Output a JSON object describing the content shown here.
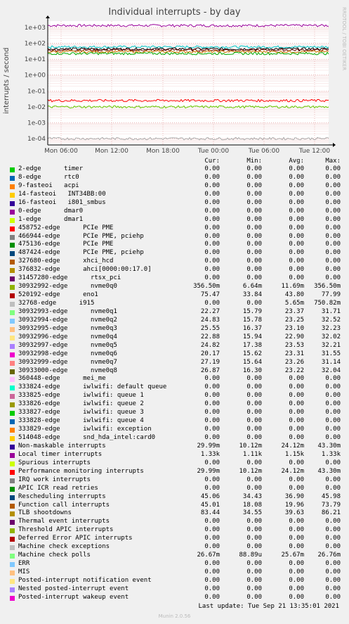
{
  "chart_data": {
    "type": "line",
    "title": "Individual interrupts - by day",
    "ylabel": "interrupts / second",
    "y_scale": "log",
    "yticks": [
      "1e+03",
      "1e+02",
      "1e+01",
      "1e+00",
      "1e-01",
      "1e-02",
      "1e-03",
      "1e-04"
    ],
    "xticks": [
      "Mon 06:00",
      "Mon 12:00",
      "Mon 18:00",
      "Tue 00:00",
      "Tue 06:00",
      "Tue 12:00"
    ],
    "side_label": "RRDTOOL / TOBI OETIKER",
    "grid": true,
    "series_bands": [
      {
        "color": "#990099",
        "level": 1330
      },
      {
        "color": "#00cccc",
        "level": 60
      },
      {
        "color": "#000000",
        "level": 45
      },
      {
        "color": "#660000",
        "level": 38
      },
      {
        "color": "#cc7700",
        "level": 30
      },
      {
        "color": "#00aa00",
        "level": 23
      },
      {
        "color": "#ff0000",
        "level": 0.025
      },
      {
        "color": "#66cc00",
        "level": 0.01
      },
      {
        "color": "#aaaaaa",
        "level": 0.0001
      }
    ],
    "legend_columns": [
      "Cur:",
      "Min:",
      "Avg:",
      "Max:"
    ],
    "rows": [
      {
        "name": "2-edge      timer",
        "color": "#00cc00",
        "cur": "0.00",
        "min": "0.00",
        "avg": "0.00",
        "max": "0.00"
      },
      {
        "name": "8-edge      rtc0",
        "color": "#0066b3",
        "cur": "0.00",
        "min": "0.00",
        "avg": "0.00",
        "max": "0.00"
      },
      {
        "name": "9-fasteoi   acpi",
        "color": "#ff8000",
        "cur": "0.00",
        "min": "0.00",
        "avg": "0.00",
        "max": "0.00"
      },
      {
        "name": "14-fasteoi   INT34BB:00",
        "color": "#ffcc00",
        "cur": "0.00",
        "min": "0.00",
        "avg": "0.00",
        "max": "0.00"
      },
      {
        "name": "16-fasteoi   i801_smbus",
        "color": "#330099",
        "cur": "0.00",
        "min": "0.00",
        "avg": "0.00",
        "max": "0.00"
      },
      {
        "name": "0-edge      dmar0",
        "color": "#990099",
        "cur": "0.00",
        "min": "0.00",
        "avg": "0.00",
        "max": "0.00"
      },
      {
        "name": "1-edge      dmar1",
        "color": "#ccff00",
        "cur": "0.00",
        "min": "0.00",
        "avg": "0.00",
        "max": "0.00"
      },
      {
        "name": "458752-edge      PCIe PME",
        "color": "#ff0000",
        "cur": "0.00",
        "min": "0.00",
        "avg": "0.00",
        "max": "0.00"
      },
      {
        "name": "466944-edge      PCIe PME, pciehp",
        "color": "#808080",
        "cur": "0.00",
        "min": "0.00",
        "avg": "0.00",
        "max": "0.00"
      },
      {
        "name": "475136-edge      PCIe PME",
        "color": "#008f00",
        "cur": "0.00",
        "min": "0.00",
        "avg": "0.00",
        "max": "0.00"
      },
      {
        "name": "487424-edge      PCIe PME, pciehp",
        "color": "#00487d",
        "cur": "0.00",
        "min": "0.00",
        "avg": "0.00",
        "max": "0.00"
      },
      {
        "name": "327680-edge      xhci_hcd",
        "color": "#b35a00",
        "cur": "0.00",
        "min": "0.00",
        "avg": "0.00",
        "max": "0.00"
      },
      {
        "name": "376832-edge      ahci[0000:00:17.0]",
        "color": "#b38f00",
        "cur": "0.00",
        "min": "0.00",
        "avg": "0.00",
        "max": "0.00"
      },
      {
        "name": "31457280-edge      rtsx_pci",
        "color": "#6b006b",
        "cur": "0.00",
        "min": "0.00",
        "avg": "0.00",
        "max": "0.00"
      },
      {
        "name": "30932992-edge      nvme0q0",
        "color": "#8fb300",
        "cur": "356.50m",
        "min": "6.64m",
        "avg": "11.69m",
        "max": "356.50m"
      },
      {
        "name": "520192-edge      eno1",
        "color": "#b30000",
        "cur": "75.47",
        "min": "33.84",
        "avg": "43.80",
        "max": "77.99"
      },
      {
        "name": "32768-edge      i915",
        "color": "#bebebe",
        "cur": "0.00",
        "min": "0.00",
        "avg": "5.65m",
        "max": "750.82m"
      },
      {
        "name": "30932993-edge      nvme0q1",
        "color": "#80ff80",
        "cur": "22.27",
        "min": "15.79",
        "avg": "23.37",
        "max": "31.71"
      },
      {
        "name": "30932994-edge      nvme0q2",
        "color": "#80c9ff",
        "cur": "24.83",
        "min": "15.78",
        "avg": "23.25",
        "max": "32.52"
      },
      {
        "name": "30932995-edge      nvme0q3",
        "color": "#ffc080",
        "cur": "25.55",
        "min": "16.37",
        "avg": "23.10",
        "max": "32.23"
      },
      {
        "name": "30932996-edge      nvme0q4",
        "color": "#ffe680",
        "cur": "22.88",
        "min": "15.94",
        "avg": "22.90",
        "max": "32.02"
      },
      {
        "name": "30932997-edge      nvme0q5",
        "color": "#aa80ff",
        "cur": "24.82",
        "min": "17.38",
        "avg": "23.53",
        "max": "32.21"
      },
      {
        "name": "30932998-edge      nvme0q6",
        "color": "#ee00cc",
        "cur": "20.17",
        "min": "15.62",
        "avg": "23.31",
        "max": "31.55"
      },
      {
        "name": "30932999-edge      nvme0q7",
        "color": "#ff8080",
        "cur": "27.19",
        "min": "15.64",
        "avg": "23.26",
        "max": "31.14"
      },
      {
        "name": "30933000-edge      nvme0q8",
        "color": "#666600",
        "cur": "26.87",
        "min": "16.30",
        "avg": "23.22",
        "max": "32.04"
      },
      {
        "name": "360448-edge      mei_me",
        "color": "#ffbfff",
        "cur": "0.00",
        "min": "0.00",
        "avg": "0.00",
        "max": "0.00"
      },
      {
        "name": "333824-edge      iwlwifi: default queue",
        "color": "#00ffcc",
        "cur": "0.00",
        "min": "0.00",
        "avg": "0.00",
        "max": "0.00"
      },
      {
        "name": "333825-edge      iwlwifi: queue 1",
        "color": "#cc6699",
        "cur": "0.00",
        "min": "0.00",
        "avg": "0.00",
        "max": "0.00"
      },
      {
        "name": "333826-edge      iwlwifi: queue 2",
        "color": "#999900",
        "cur": "0.00",
        "min": "0.00",
        "avg": "0.00",
        "max": "0.00"
      },
      {
        "name": "333827-edge      iwlwifi: queue 3",
        "color": "#00cc00",
        "cur": "0.00",
        "min": "0.00",
        "avg": "0.00",
        "max": "0.00"
      },
      {
        "name": "333828-edge      iwlwifi: queue 4",
        "color": "#0066b3",
        "cur": "0.00",
        "min": "0.00",
        "avg": "0.00",
        "max": "0.00"
      },
      {
        "name": "333829-edge      iwlwifi: exception",
        "color": "#ff8000",
        "cur": "0.00",
        "min": "0.00",
        "avg": "0.00",
        "max": "0.00"
      },
      {
        "name": "514048-edge      snd_hda_intel:card0",
        "color": "#ffcc00",
        "cur": "0.00",
        "min": "0.00",
        "avg": "0.00",
        "max": "0.00"
      },
      {
        "name": "Non-maskable interrupts",
        "color": "#330099",
        "cur": "29.99m",
        "min": "10.12m",
        "avg": "24.12m",
        "max": "43.30m"
      },
      {
        "name": "Local timer interrupts",
        "color": "#990099",
        "cur": "1.33k",
        "min": "1.11k",
        "avg": "1.15k",
        "max": "1.33k"
      },
      {
        "name": "Spurious interrupts",
        "color": "#ccff00",
        "cur": "0.00",
        "min": "0.00",
        "avg": "0.00",
        "max": "0.00"
      },
      {
        "name": "Performance monitoring interrupts",
        "color": "#ff0000",
        "cur": "29.99m",
        "min": "10.12m",
        "avg": "24.12m",
        "max": "43.30m"
      },
      {
        "name": "IRQ work interrupts",
        "color": "#808080",
        "cur": "0.00",
        "min": "0.00",
        "avg": "0.00",
        "max": "0.00"
      },
      {
        "name": "APIC ICR read retries",
        "color": "#008f00",
        "cur": "0.00",
        "min": "0.00",
        "avg": "0.00",
        "max": "0.00"
      },
      {
        "name": "Rescheduling interrupts",
        "color": "#00487d",
        "cur": "45.06",
        "min": "34.43",
        "avg": "36.90",
        "max": "45.98"
      },
      {
        "name": "Function call interrupts",
        "color": "#b35a00",
        "cur": "45.01",
        "min": "18.08",
        "avg": "19.96",
        "max": "73.79"
      },
      {
        "name": "TLB shootdowns",
        "color": "#b38f00",
        "cur": "83.44",
        "min": "34.55",
        "avg": "39.63",
        "max": "86.21"
      },
      {
        "name": "Thermal event interrupts",
        "color": "#6b006b",
        "cur": "0.00",
        "min": "0.00",
        "avg": "0.00",
        "max": "0.00"
      },
      {
        "name": "Threshold APIC interrupts",
        "color": "#8fb300",
        "cur": "0.00",
        "min": "0.00",
        "avg": "0.00",
        "max": "0.00"
      },
      {
        "name": "Deferred Error APIC interrupts",
        "color": "#b30000",
        "cur": "0.00",
        "min": "0.00",
        "avg": "0.00",
        "max": "0.00"
      },
      {
        "name": "Machine check exceptions",
        "color": "#bebebe",
        "cur": "0.00",
        "min": "0.00",
        "avg": "0.00",
        "max": "0.00"
      },
      {
        "name": "Machine check polls",
        "color": "#80ff80",
        "cur": "26.67m",
        "min": "88.89u",
        "avg": "25.67m",
        "max": "26.76m"
      },
      {
        "name": "ERR",
        "color": "#80c9ff",
        "cur": "0.00",
        "min": "0.00",
        "avg": "0.00",
        "max": "0.00"
      },
      {
        "name": "MIS",
        "color": "#ffc080",
        "cur": "0.00",
        "min": "0.00",
        "avg": "0.00",
        "max": "0.00"
      },
      {
        "name": "Posted-interrupt notification event",
        "color": "#ffe680",
        "cur": "0.00",
        "min": "0.00",
        "avg": "0.00",
        "max": "0.00"
      },
      {
        "name": "Nested posted-interrupt event",
        "color": "#aa80ff",
        "cur": "0.00",
        "min": "0.00",
        "avg": "0.00",
        "max": "0.00"
      },
      {
        "name": "Posted-interrupt wakeup event",
        "color": "#ee00cc",
        "cur": "0.00",
        "min": "0.00",
        "avg": "0.00",
        "max": "0.00"
      }
    ]
  },
  "footer": {
    "last_update": "Last update: Tue Sep 21 13:35:01 2021",
    "version": "Munin 2.0.56"
  }
}
